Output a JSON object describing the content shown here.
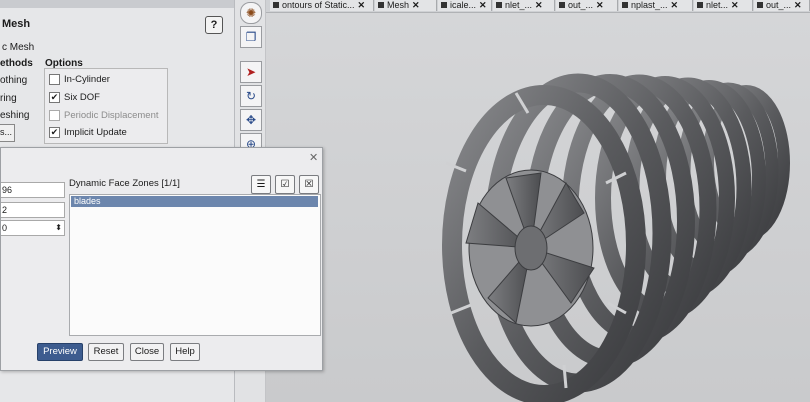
{
  "panel": {
    "title": "Mesh",
    "subtitle": "c Mesh",
    "help_label": "?",
    "methods_header": "ethods",
    "options_header": "Options",
    "methods": [
      "othing",
      "ring",
      "eshing"
    ],
    "methods_button": "s...",
    "options": [
      {
        "label": "In-Cylinder",
        "checked": false,
        "disabled": false
      },
      {
        "label": "Six DOF",
        "checked": true,
        "disabled": false
      },
      {
        "label": "Periodic Displacement",
        "checked": false,
        "disabled": true
      },
      {
        "label": "Implicit Update",
        "checked": true,
        "disabled": false
      }
    ]
  },
  "tabs": [
    {
      "label": "ontours of Static..."
    },
    {
      "label": "Mesh"
    },
    {
      "label": "icale..."
    },
    {
      "label": "nlet_..."
    },
    {
      "label": "out_..."
    },
    {
      "label": "nplast_..."
    },
    {
      "label": "nlet..."
    },
    {
      "label": "out_..."
    }
  ],
  "toolbar_icons": [
    "fit-view-icon",
    "layers-icon",
    "pointer-icon",
    "rotate-icon",
    "pan-icon",
    "zoom-icon"
  ],
  "dialog": {
    "field_values": [
      "96",
      "2",
      "0"
    ],
    "dynamic_zones_label": "Dynamic Face Zones  [1/1]",
    "zones": [
      "blades"
    ],
    "buttons": {
      "preview": "Preview",
      "reset": "Reset",
      "close": "Close",
      "help": "Help"
    }
  },
  "colors": {
    "accent": "#3d5c8f",
    "selection": "#6c86ad"
  }
}
